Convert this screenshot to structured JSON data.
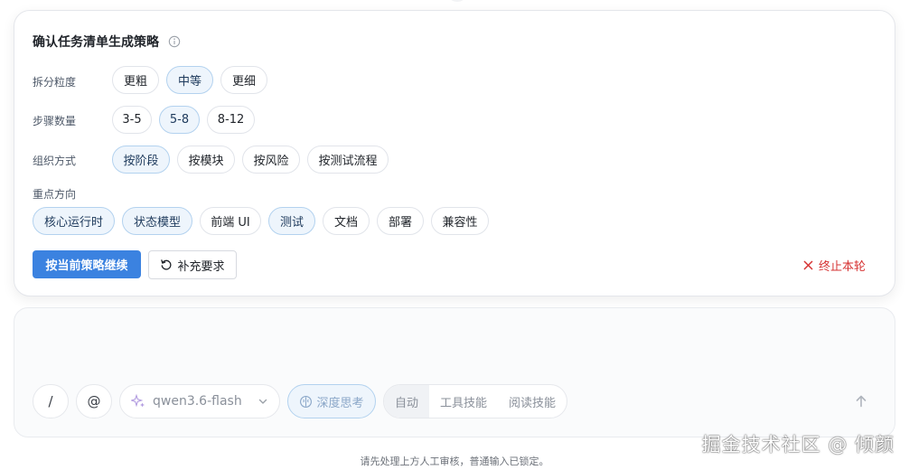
{
  "card": {
    "title": "确认任务清单生成策略",
    "rows": [
      {
        "label": "拆分粒度",
        "options": [
          {
            "label": "更粗",
            "selected": false
          },
          {
            "label": "中等",
            "selected": true
          },
          {
            "label": "更细",
            "selected": false
          }
        ]
      },
      {
        "label": "步骤数量",
        "options": [
          {
            "label": "3-5",
            "selected": false
          },
          {
            "label": "5-8",
            "selected": true
          },
          {
            "label": "8-12",
            "selected": false
          }
        ]
      },
      {
        "label": "组织方式",
        "options": [
          {
            "label": "按阶段",
            "selected": true
          },
          {
            "label": "按模块",
            "selected": false
          },
          {
            "label": "按风险",
            "selected": false
          },
          {
            "label": "按测试流程",
            "selected": false
          }
        ]
      },
      {
        "label": "重点方向",
        "options": [
          {
            "label": "核心运行时",
            "selected": true
          },
          {
            "label": "状态模型",
            "selected": true
          },
          {
            "label": "前端 UI",
            "selected": false
          },
          {
            "label": "测试",
            "selected": true
          },
          {
            "label": "文档",
            "selected": false
          },
          {
            "label": "部署",
            "selected": false
          },
          {
            "label": "兼容性",
            "selected": false
          }
        ]
      }
    ],
    "continue_label": "按当前策略继续",
    "supplement_label": "补充要求",
    "stop_label": "终止本轮"
  },
  "composer": {
    "slash_label": "/",
    "at_label": "@",
    "model_name": "qwen3.6-flash",
    "deep_think_label": "深度思考",
    "modes": [
      {
        "label": "自动",
        "active": true
      },
      {
        "label": "工具技能",
        "active": false
      },
      {
        "label": "阅读技能",
        "active": false
      }
    ]
  },
  "watermark": "掘金技术社区 @ 倾颜",
  "footer_note": "请先处理上方人工审核，普通输入已锁定。",
  "colors": {
    "primary": "#3b82e0",
    "selected_bg": "#eef5fc",
    "selected_border": "#b3d2ef",
    "danger": "#d63333"
  }
}
